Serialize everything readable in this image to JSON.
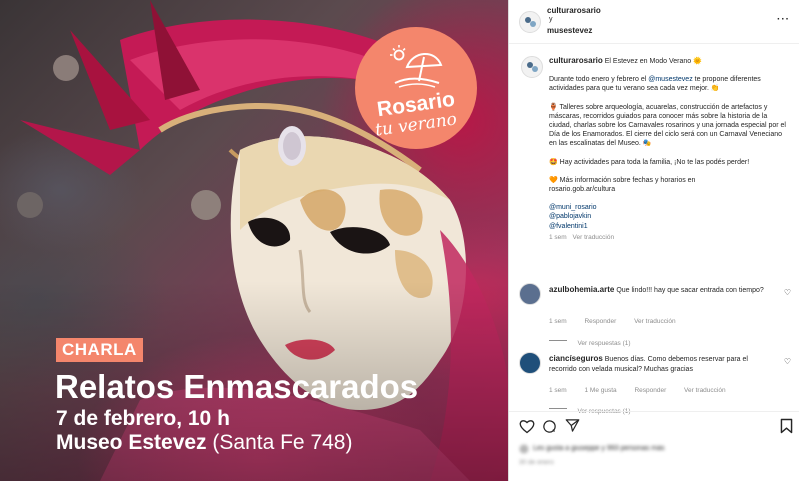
{
  "media": {
    "tag": "CHARLA",
    "title": "Relatos Enmascarados",
    "date": "7 de febrero, 10 h",
    "place_bold": "Museo Estevez",
    "place_rest": " (Santa Fe 748)",
    "badge_line1": "Rosario",
    "badge_line2": "tu verano"
  },
  "header": {
    "user1": "culturarosario",
    "and": "y",
    "user2": "musestevez",
    "more": "···"
  },
  "caption": {
    "user": "culturarosario",
    "first_line": "El Estevez en Modo Verano 🌞",
    "p1_a": "Durante todo enero y febrero el ",
    "p1_mention": "@musestevez",
    "p1_b": " te propone diferentes actividades para que tu verano sea cada vez mejor. 👏",
    "p2": "🏺 Talleres sobre arqueología, acuarelas, construcción de artefactos y máscaras, recorridos guiados para conocer más sobre la historia de la ciudad, charlas sobre los Carnavales rosarinos y una jornada especial por el Día de los Enamorados. El cierre del ciclo será con un Carnaval Veneciano en las escalinatas del Museo. 🎭",
    "p3": "🤩 Hay actividades para toda la familia, ¡No te las podés perder!",
    "p4a": "🧡 Más información sobre fechas y horarios en",
    "p4b": "rosario.gob.ar/cultura",
    "mentions": [
      "@muni_rosario",
      "@pablojavkin",
      "@fvalentini1"
    ],
    "time": "1 sem",
    "translate": "Ver traducción"
  },
  "comments": [
    {
      "user": "azulbohemia.arte",
      "text": "Que lindo!!! hay que sacar entrada con tiempo?",
      "time": "1 sem",
      "reply": "Responder",
      "translate": "Ver traducción",
      "replies": "Ver respuestas (1)"
    },
    {
      "user": "ciancíseguros",
      "text": "Buenos días. Como debemos reservar para el recorrido con velada musical? Muchas gracias",
      "time": "1 sem",
      "likes": "1 Me gusta",
      "reply": "Responder",
      "translate": "Ver traducción",
      "replies": "Ver respuestas (1)"
    }
  ],
  "footer": {
    "likes_text": "Les gusta a giuseppe y 993 personas más",
    "date_text": "30 de enero"
  },
  "icons": {
    "like": "heart-icon",
    "comment": "comment-icon",
    "share": "send-icon",
    "save": "bookmark-icon"
  },
  "colors": {
    "accent": "#f4866c",
    "link": "#00376b",
    "muted": "#8e8e8e"
  }
}
